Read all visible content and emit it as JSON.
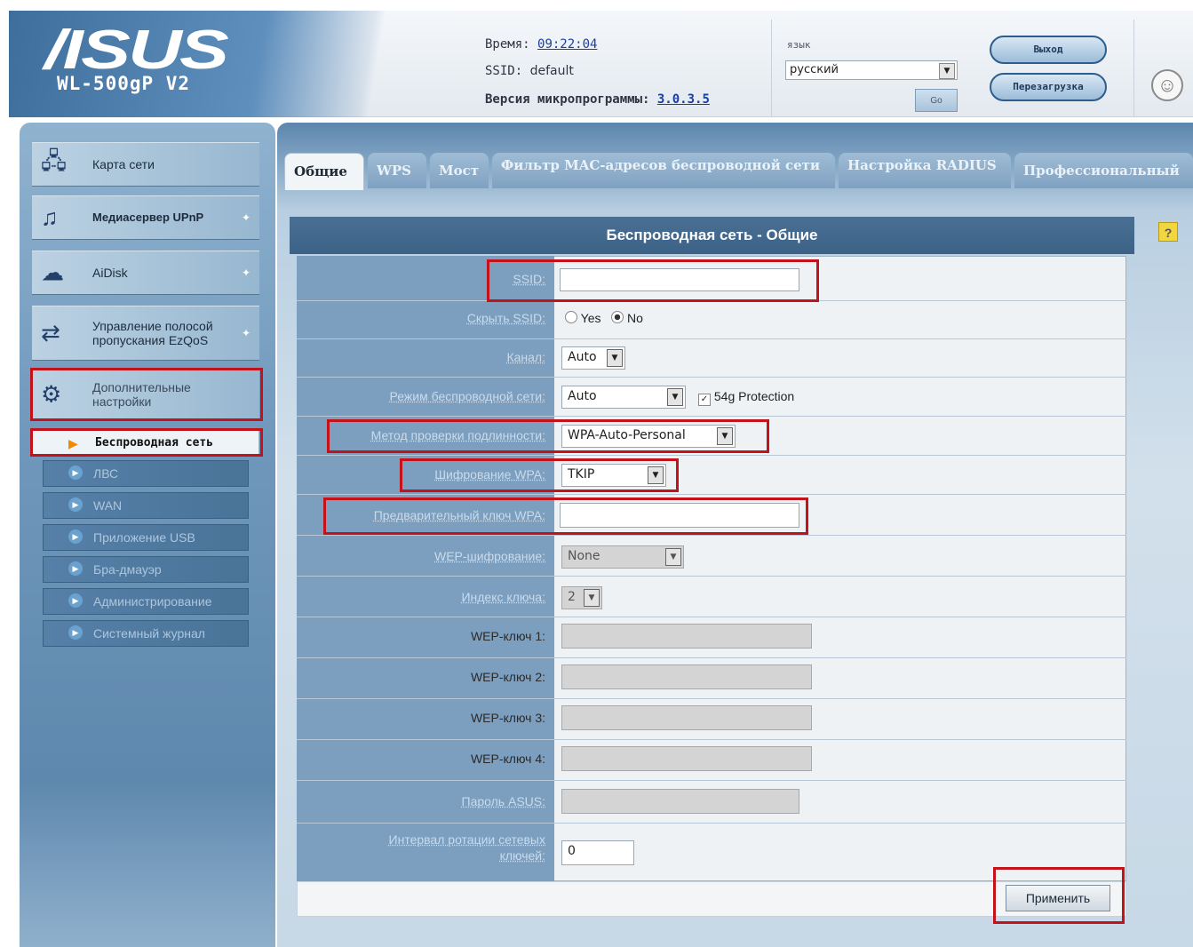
{
  "header": {
    "logo": "/ISUS",
    "model": "WL-500gP V2",
    "time_label": "Время:",
    "time_value": "09:22:04",
    "ssid_label": "SSID:",
    "ssid_value": "default",
    "firmware_label": "Версия микропрограммы:",
    "firmware_value": "3.0.3.5",
    "language_label": "язык",
    "language_value": "русский",
    "language_go": "Go",
    "logout": "Выход",
    "reboot": "Перезагрузка"
  },
  "sidebar": {
    "items": [
      {
        "label": "Карта сети",
        "icon": "network-map-icon"
      },
      {
        "label": "Медиасервер UPnP",
        "icon": "media-server-icon"
      },
      {
        "label": "AiDisk",
        "icon": "aidisk-icon"
      },
      {
        "label": "Управление полосой пропускания EzQoS",
        "icon": "qos-icon"
      },
      {
        "label": "Дополнительные настройки",
        "icon": "settings-icon"
      }
    ],
    "sub_items": [
      "Беспроводная сеть",
      "ЛВС",
      "WAN",
      "Приложение USB",
      "Бра-дмауэр",
      "Администрирование",
      "Системный журнал"
    ]
  },
  "tabs": [
    "Общие",
    "WPS",
    "Мост",
    "Фильтр MAC-адресов беспроводной сети",
    "Настройка RADIUS",
    "Профессиональный"
  ],
  "panel": {
    "title": "Беспроводная сеть - Общие",
    "ssid_label": "SSID:",
    "ssid_value": "",
    "hide_ssid_label": "Скрыть SSID:",
    "hide_yes": "Yes",
    "hide_no": "No",
    "channel_label": "Канал:",
    "channel_value": "Auto",
    "mode_label": "Режим беспроводной сети:",
    "mode_value": "Auto",
    "protection_label": "54g Protection",
    "auth_label": "Метод проверки подлинности:",
    "auth_value": "WPA-Auto-Personal",
    "wpa_enc_label": "Шифрование WPA:",
    "wpa_enc_value": "TKIP",
    "wpa_key_label": "Предварительный ключ WPA:",
    "wpa_key_value": "",
    "wep_enc_label": "WEP-шифрование:",
    "wep_enc_value": "None",
    "key_index_label": "Индекс ключа:",
    "key_index_value": "2",
    "wep_key1_label": "WEP-ключ 1:",
    "wep_key2_label": "WEP-ключ 2:",
    "wep_key3_label": "WEP-ключ 3:",
    "wep_key4_label": "WEP-ключ 4:",
    "asus_pass_label": "Пароль ASUS:",
    "rotation_label": "Интервал ротации сетевых ключей:",
    "rotation_value": "0",
    "apply": "Применить"
  },
  "colors": {
    "highlight": "#c4121a",
    "panel_header": "#3c6287",
    "label_column": "#7c9fbf"
  }
}
